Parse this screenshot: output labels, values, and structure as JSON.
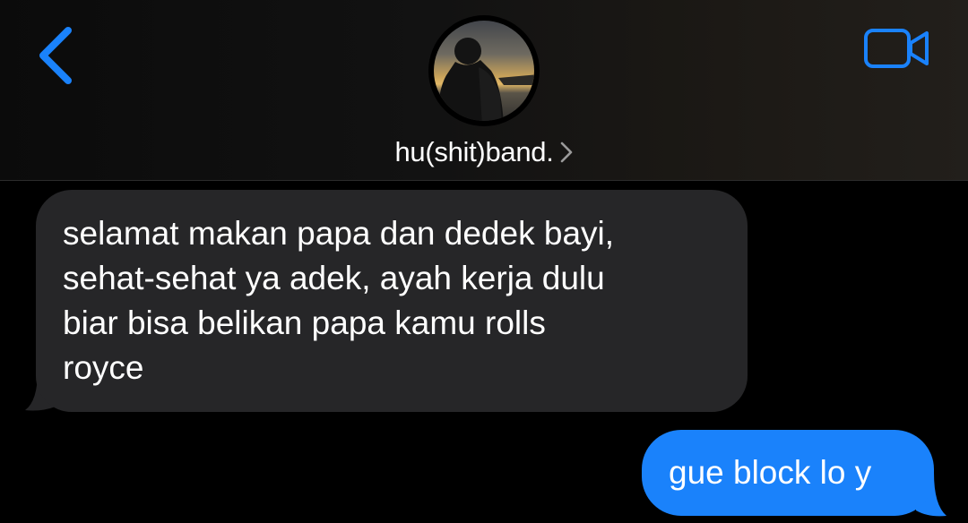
{
  "header": {
    "back_icon": "chevron-left-icon",
    "video_icon": "video-camera-icon",
    "contact_name": "hu(shit)band.",
    "chevron_icon": "chevron-right-icon"
  },
  "messages": [
    {
      "direction": "incoming",
      "text": "selamat makan papa dan dedek bayi,\nsehat-sehat ya adek, ayah kerja dulu\nbiar bisa belikan papa kamu rolls\nroyce"
    },
    {
      "direction": "outgoing",
      "text": "gue block lo y"
    }
  ],
  "colors": {
    "accent": "#1a82fb",
    "incoming_bubble": "#262628",
    "background": "#000000",
    "text": "#ffffff"
  }
}
